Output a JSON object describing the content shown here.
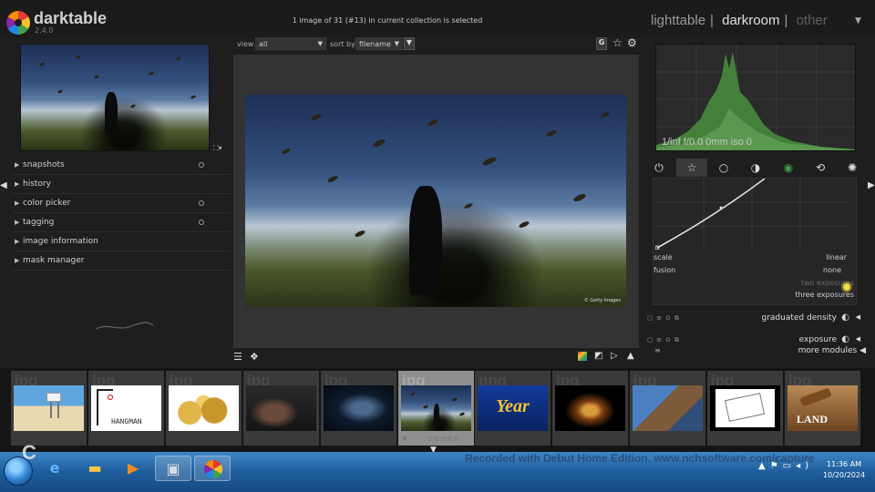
{
  "app": {
    "name": "darktable",
    "version": "2.4.0"
  },
  "header": {
    "selection_info": "1 image of 31 (#13) in current collection is selected",
    "views": {
      "lighttable": "lighttable",
      "sep1": "|",
      "darkroom": "darkroom",
      "sep2": "|",
      "other": "other",
      "active": "darkroom"
    }
  },
  "left_panel": {
    "modules": [
      {
        "label": "snapshots",
        "has_reset": true
      },
      {
        "label": "history",
        "has_reset": false
      },
      {
        "label": "color picker",
        "has_reset": true
      },
      {
        "label": "tagging",
        "has_reset": true
      },
      {
        "label": "image information",
        "has_reset": false
      },
      {
        "label": "mask manager",
        "has_reset": false
      }
    ]
  },
  "center_top": {
    "view_label": "view",
    "view_value": "all",
    "sort_label": "sort by",
    "sort_value": "filename",
    "icons": [
      "grouping-icon",
      "star-icon",
      "gear-icon"
    ],
    "grouping_letter": "G"
  },
  "main_image": {
    "credit": "© Getty Images"
  },
  "right_panel": {
    "histogram_info": "1/inf f/0.0 0mm iso 0",
    "module_groups": [
      "power-icon",
      "favorites-icon",
      "basic-circle-icon",
      "tone-circle-icon",
      "color-circle-icon",
      "correct-icon",
      "effect-icon"
    ],
    "curve": {
      "scale_label": "scale",
      "scale_value": "linear",
      "fusion_label": "fusion",
      "fusion_value": "none",
      "fusion_options": [
        "two exposures",
        "three exposures"
      ],
      "highlighted_option": "two exposures"
    },
    "modules": [
      {
        "name": "graduated density"
      },
      {
        "name": "exposure"
      }
    ],
    "more_modules": "more modules"
  },
  "filmstrip": {
    "thumbnails": [
      {
        "ext": "jpg",
        "subject": "lifeguard tower beach",
        "selected": false
      },
      {
        "ext": "jpg",
        "subject": "HANGMAN",
        "caption": "HANGMAN",
        "selected": false
      },
      {
        "ext": "jpg",
        "subject": "gold coins",
        "selected": false
      },
      {
        "ext": "jpg",
        "subject": "blacksmith",
        "selected": false
      },
      {
        "ext": "jpg",
        "subject": "face in dark",
        "selected": false
      },
      {
        "ext": "jpg",
        "subject": "locusts",
        "selected": true
      },
      {
        "ext": "png",
        "subject": "Year",
        "caption": "Year",
        "selected": false
      },
      {
        "ext": "jpg",
        "subject": "dancer",
        "selected": false
      },
      {
        "ext": "jpg",
        "subject": "statue",
        "selected": false
      },
      {
        "ext": "jpg",
        "subject": "sketch",
        "selected": false
      },
      {
        "ext": "jpg",
        "subject": "LAND gavel",
        "caption": "LAND",
        "selected": false
      }
    ],
    "selected_stars": "☆☆☆☆☆"
  },
  "taskbar": {
    "recording_banner": "Recorded with Debut Home Edition. www.nchsoftware.com/capture",
    "clock_time": "11:36 AM",
    "clock_date": "10/20/2024",
    "overlay_letter": "C"
  },
  "colors": {
    "background": "#1e1e1e",
    "center_bg": "#333333",
    "histogram_green": "#4caf50",
    "taskbar_blue": "#1f5d9c"
  }
}
